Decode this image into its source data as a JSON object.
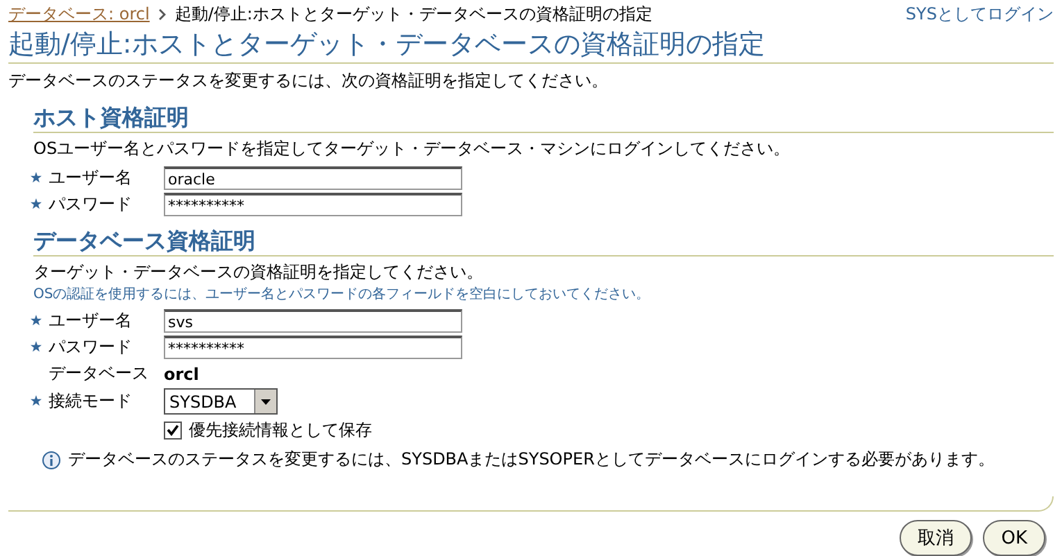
{
  "breadcrumb": {
    "link": "データベース: orcl",
    "current": "起動/停止:ホストとターゲット・データベースの資格証明の指定"
  },
  "login_link": "SYSとしてログイン",
  "title": "起動/停止:ホストとターゲット・データベースの資格証明の指定",
  "intro": "データベースのステータスを変更するには、次の資格証明を指定してください。",
  "host_section": {
    "heading": "ホスト資格証明",
    "description": "OSユーザー名とパスワードを指定してターゲット・データベース・マシンにログインしてください。",
    "fields": [
      {
        "kind": "text",
        "required": true,
        "label": "ユーザー名",
        "value": "oracle"
      },
      {
        "kind": "text",
        "required": true,
        "label": "パスワード",
        "value": "**********"
      }
    ]
  },
  "database_section": {
    "heading": "データベース資格証明",
    "description": "ターゲット・データベースの資格証明を指定してください。",
    "hint": "OSの認証を使用するには、ユーザー名とパスワードの各フィールドを空白にしておいてください。",
    "fields": [
      {
        "kind": "text",
        "required": true,
        "label": "ユーザー名",
        "value": "svs"
      },
      {
        "kind": "text",
        "required": true,
        "label": "パスワード",
        "value": "**********"
      },
      {
        "kind": "static",
        "required": false,
        "label": "データベース",
        "value": "orcl"
      },
      {
        "kind": "select",
        "required": true,
        "label": "接続モード",
        "value": "SYSDBA"
      }
    ],
    "save_checkbox": {
      "label": "優先接続情報として保存",
      "checked": true
    },
    "info": "データベースのステータスを変更するには、SYSDBAまたはSYSOPERとしてデータベースにログインする必要があります。"
  },
  "buttons": [
    "取消",
    "OK"
  ]
}
